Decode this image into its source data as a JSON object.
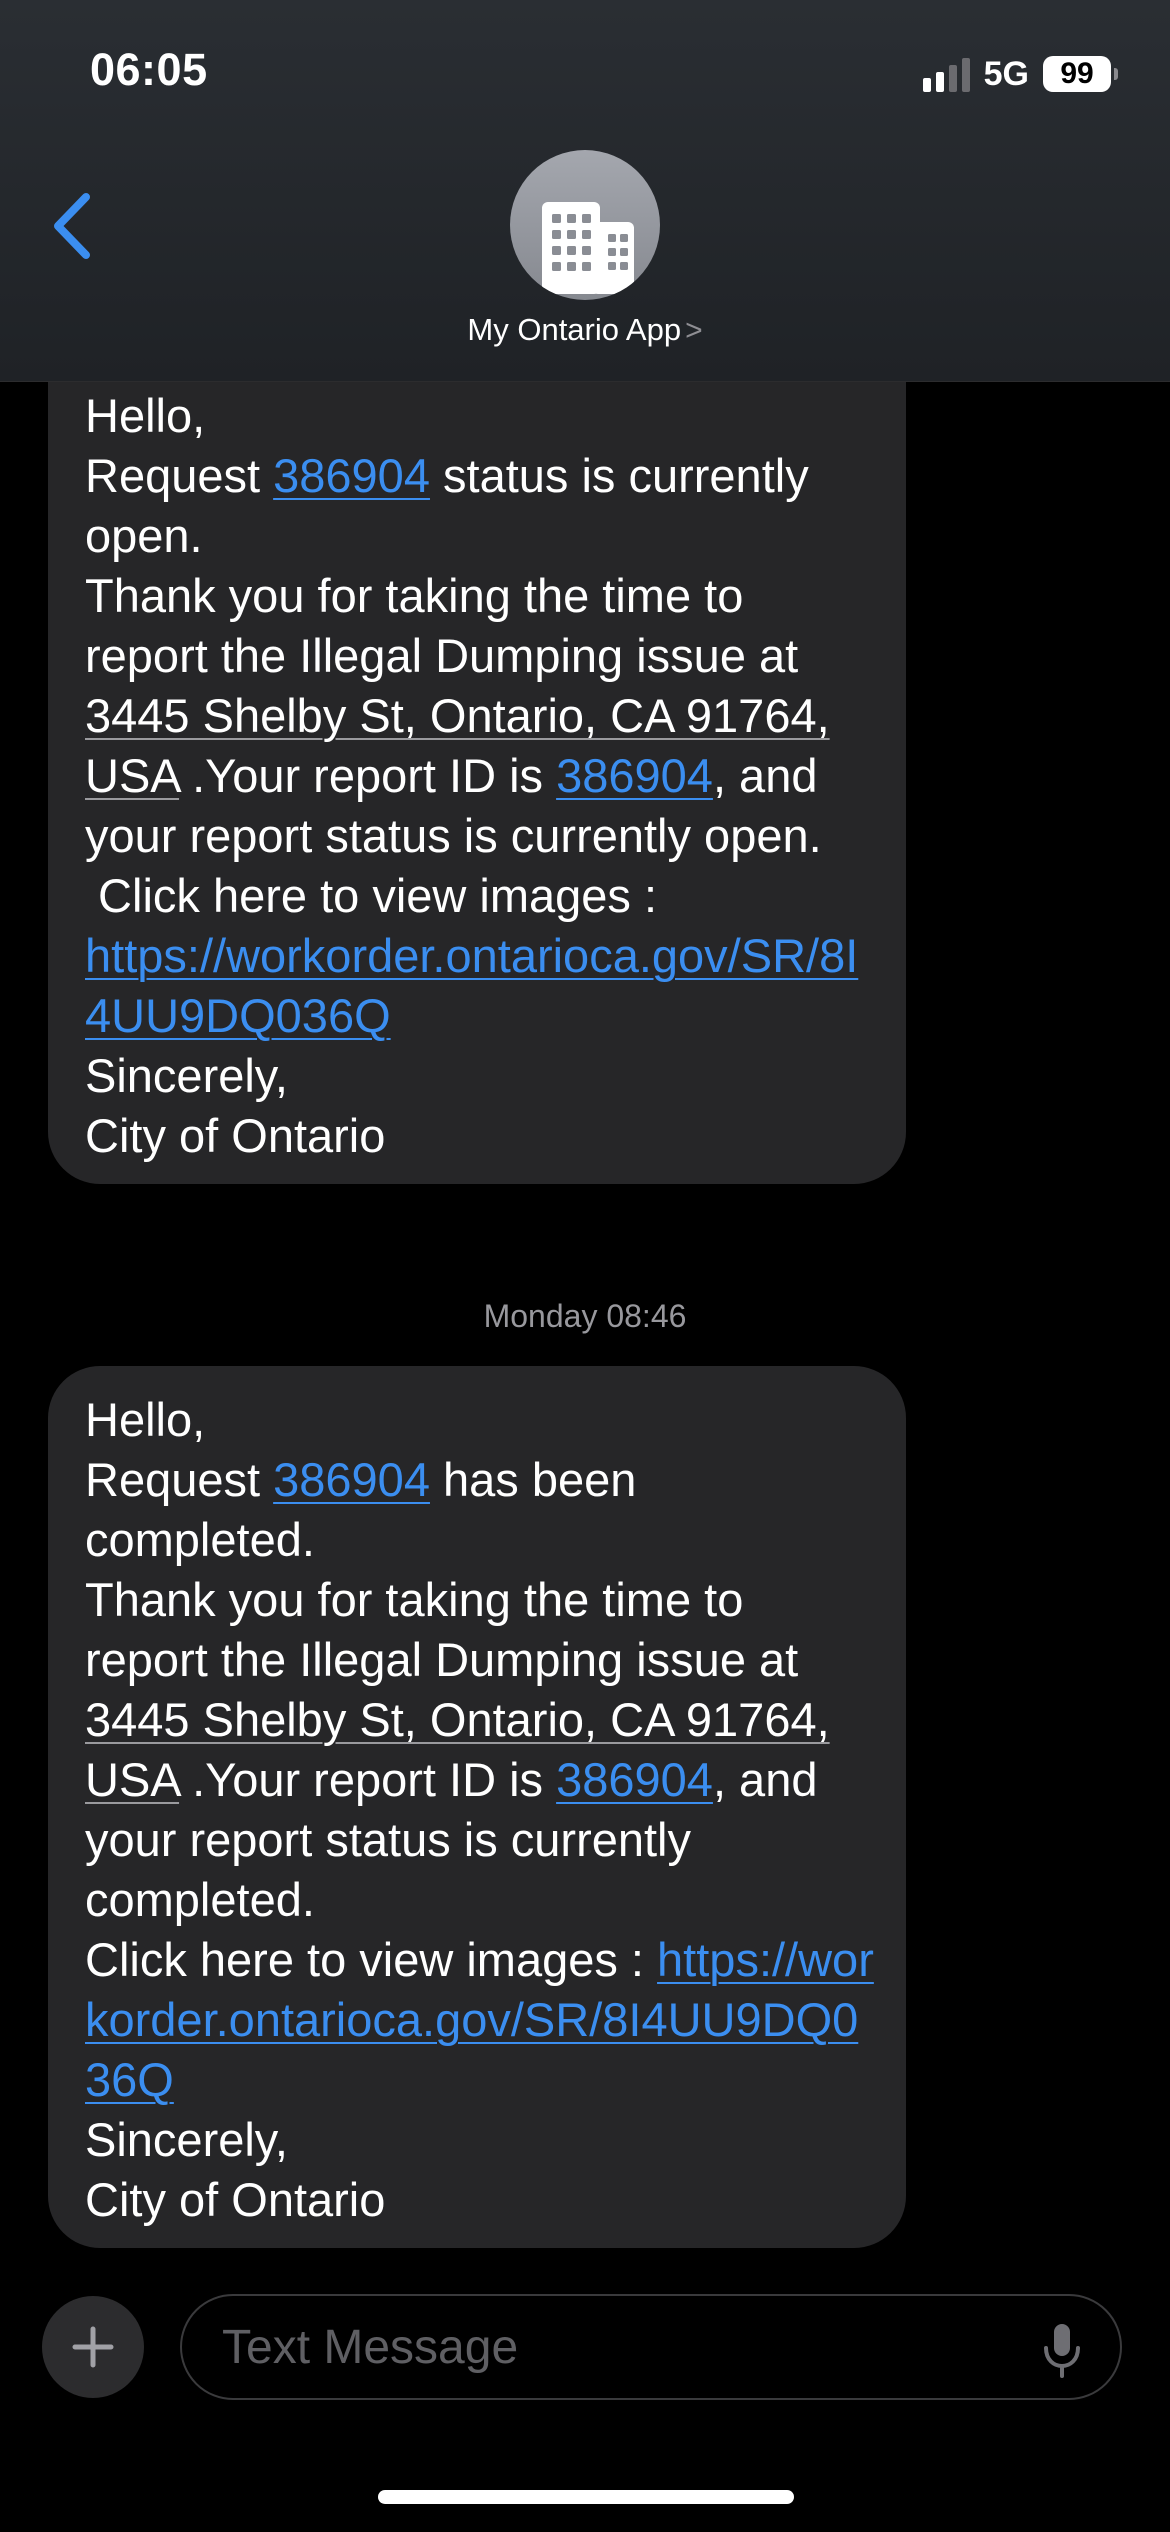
{
  "status_bar": {
    "time": "06:05",
    "network": "5G",
    "battery": "99"
  },
  "header": {
    "contact_name": "My Ontario App",
    "chevron": ">"
  },
  "messages": [
    {
      "greeting": "Hello,",
      "req_prefix": "Request ",
      "req_id": "386904",
      "req_suffix": " status is currently open.",
      "thanks": "Thank you for taking the time to report the Illegal Dumping issue at ",
      "address": "3445 Shelby St, Ontario, CA 91764, USA",
      "report_prefix": " .Your report ID is ",
      "report_id": "386904",
      "report_suffix": ", and your report status is currently open.",
      "click_text": " Click here to view images :",
      "url": "https://workorder.ontarioca.gov/SR/8I4UU9DQ036Q",
      "closing": "Sincerely,",
      "signature": "City of Ontario"
    },
    {
      "greeting": "Hello,",
      "req_prefix": "Request ",
      "req_id": "386904",
      "req_suffix": " has been completed.",
      "thanks": "Thank you for taking the time to report the Illegal Dumping issue at ",
      "address": "3445 Shelby St, Ontario, CA 91764, USA",
      "report_prefix": " .Your report ID is ",
      "report_id": "386904",
      "report_suffix": ", and your report status is currently completed.",
      "click_text": "Click here to view images : ",
      "url": "https://workorder.ontarioca.gov/SR/8I4UU9DQ036Q",
      "closing": "Sincerely,",
      "signature": "City of Ontario"
    }
  ],
  "timestamp": "Monday 08:46",
  "composer": {
    "placeholder": "Text Message"
  },
  "icons": {
    "back": "chevron-left-icon",
    "avatar": "building-icon",
    "add": "plus-icon",
    "mic": "microphone-icon"
  },
  "colors": {
    "accent": "#3b8ef0",
    "bubble": "#262628",
    "background": "#000000"
  }
}
